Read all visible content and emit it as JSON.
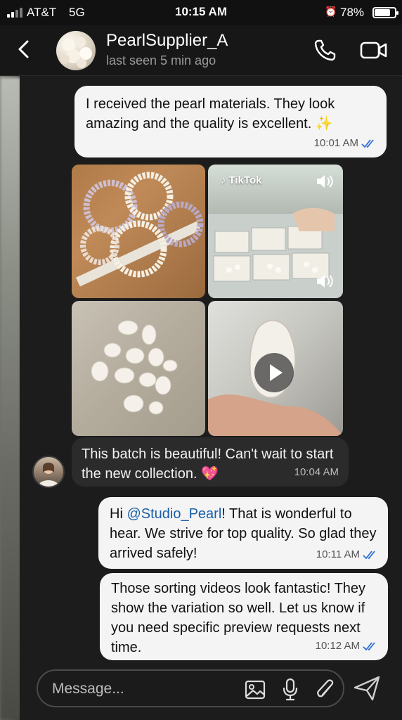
{
  "status_bar": {
    "carrier": "AT&T",
    "network": "5G",
    "time": "10:15 AM",
    "battery": "78%",
    "battery_level": 0.78
  },
  "header": {
    "contact_name": "PearlSupplier_A",
    "last_seen": "last seen 5 min ago"
  },
  "messages": [
    {
      "direction": "outgoing",
      "text": "I received the pearl materials. They look amazing and the quality is excellent. ✨",
      "time": "10:01 AM",
      "read": true
    },
    {
      "direction": "incoming",
      "type": "media",
      "tiles": [
        {
          "kind": "photo",
          "subject": "pearl strands"
        },
        {
          "kind": "video",
          "badge": "TikTok"
        },
        {
          "kind": "photo",
          "subject": "baroque pearls"
        },
        {
          "kind": "video",
          "subject": "baroque pearl in hand"
        }
      ]
    },
    {
      "direction": "incoming",
      "text": "This batch is beautiful! Can't wait to start the new collection. 💖",
      "time": "10:04 AM"
    },
    {
      "direction": "outgoing",
      "mention": "@Studio_Pearl",
      "text_before": "Hi ",
      "text_after": "! That is wonderful to hear. We strive for top quality. So glad they arrived safely!",
      "time": "10:11 AM",
      "read": true
    },
    {
      "direction": "outgoing",
      "text": "Those sorting videos look fantastic! They show the variation so well. Let us know if you need specific preview requests next time.",
      "time": "10:12 AM",
      "read": true
    }
  ],
  "composer": {
    "placeholder": "Message..."
  },
  "colors": {
    "outgoing_bubble": "#f4f4f4",
    "incoming_bubble": "#2b2b2b",
    "read_ticks": "#2f6fd6",
    "mention": "#1b5fa8"
  }
}
